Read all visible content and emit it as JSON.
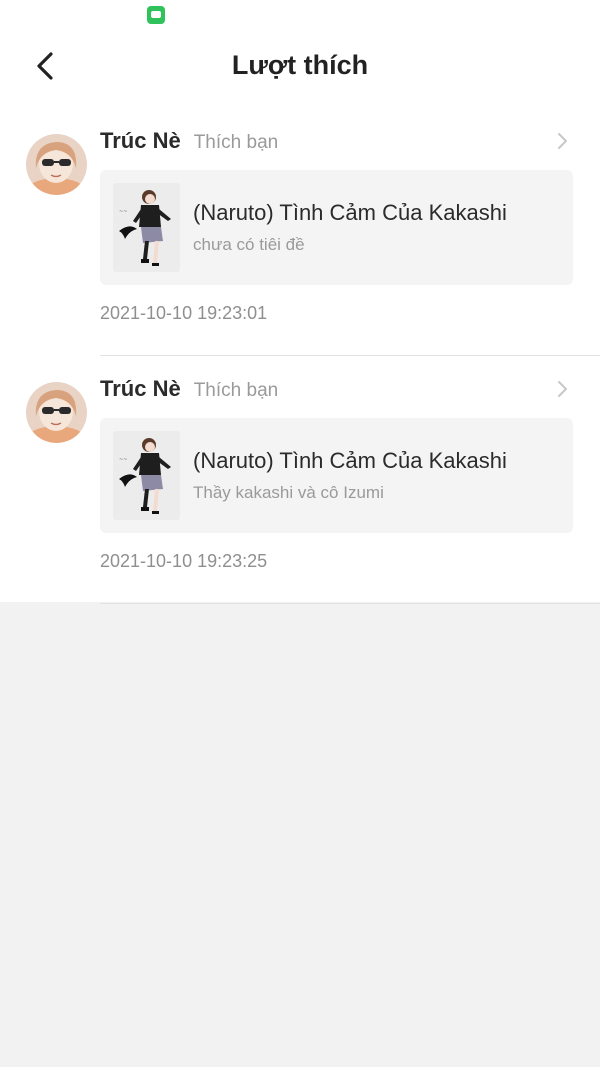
{
  "header": {
    "title": "Lượt thích",
    "back_icon": "back-arrow-icon"
  },
  "status_bar": {
    "app_icon": "android-app-icon",
    "app_icon_color": "#2fc25b"
  },
  "likes": [
    {
      "user_name": "Trúc Nè",
      "action": "Thích bạn",
      "post_title": "(Naruto) Tình Cảm Của Kakashi",
      "post_subtitle": "chưa có tiêi đề",
      "timestamp": "2021-10-10 19:23:01"
    },
    {
      "user_name": "Trúc Nè",
      "action": "Thích bạn",
      "post_title": "(Naruto) Tình Cảm Của Kakashi",
      "post_subtitle": "Thầy kakashi và cô Izumi",
      "timestamp": "2021-10-10 19:23:25"
    }
  ],
  "colors": {
    "page_background": "#f2f2f2",
    "card_background": "#f4f4f4",
    "primary_text": "#2b2b2b",
    "secondary_text": "#9a9a9a"
  }
}
